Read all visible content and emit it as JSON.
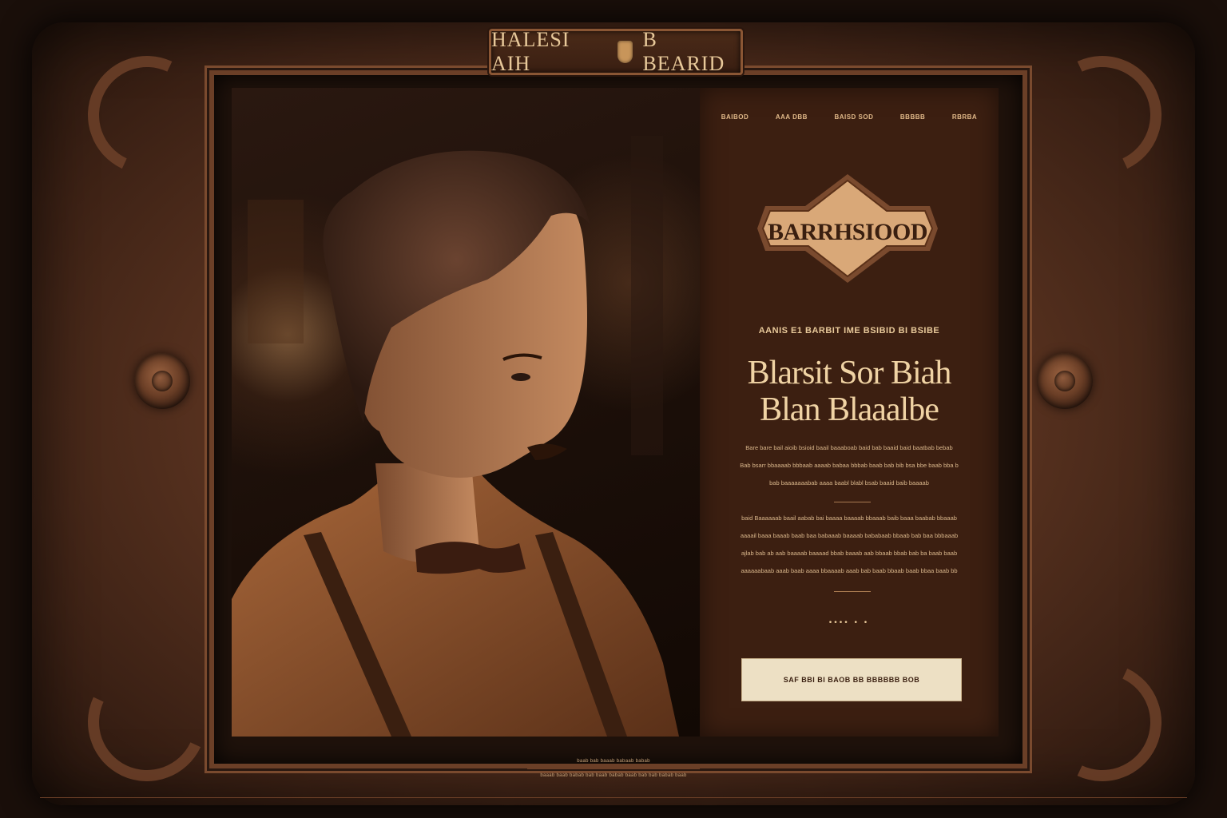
{
  "header": {
    "plaque_left": "HALESI AIH",
    "plaque_right": "B BEARID"
  },
  "nav": {
    "items": [
      "BAIBOD",
      "AAA DBB",
      "BAISD SOD",
      "BBBBB",
      "RBRBA"
    ]
  },
  "badge": {
    "title": "BARRHSIOOD"
  },
  "hero": {
    "eyebrow": "AANIS E1 BARBIT IME BSIBID BI BSIBE",
    "headline_line1": "Blarsit Sor Biah",
    "headline_line2": "Blan Blaaalbe"
  },
  "intro": {
    "line1": "Bare bare bail aioib bsioid baail baaaboab baid bab baaid baid baatbab bebab",
    "line2": "Bab bsarr bbaaaab bbbaab aaaab babaa bbbab baab bab bib bsa bbe baab bba b",
    "line3": "bab baaaaaaabab aaaa baabl blabl bsab baaid baib baaaab"
  },
  "details": {
    "line1": "baid Baaaaaab baail aabab bai baaaa baaaab bbaaab baib baaa baabab bbaaab",
    "line2": "aaaail baaa baaab baab baa babaaab baaaab bababaab bbaab bab baa bbbaaab",
    "line3": "ajlab bab ab aab baaaab baaaad bbab baaab aab bbaab bbab bab ba baab baab",
    "line4": "aaaaaabaab aaab baab aaaa bbaaaab aaab bab baab bbaab baab bbaa baab bb"
  },
  "carousel": {
    "dots": "•••• • •"
  },
  "cta": {
    "label": "SAF BBI BI BAOB BB BBBBBB BOB"
  },
  "footer": {
    "line1": "baab bab baaab babaab babab",
    "line2": "baaab baab babab bab baab babab baab bab bab babab baab"
  },
  "colors": {
    "panel": "#3c1f11",
    "accent": "#e8c99a",
    "cta_bg": "#ede0c4"
  }
}
